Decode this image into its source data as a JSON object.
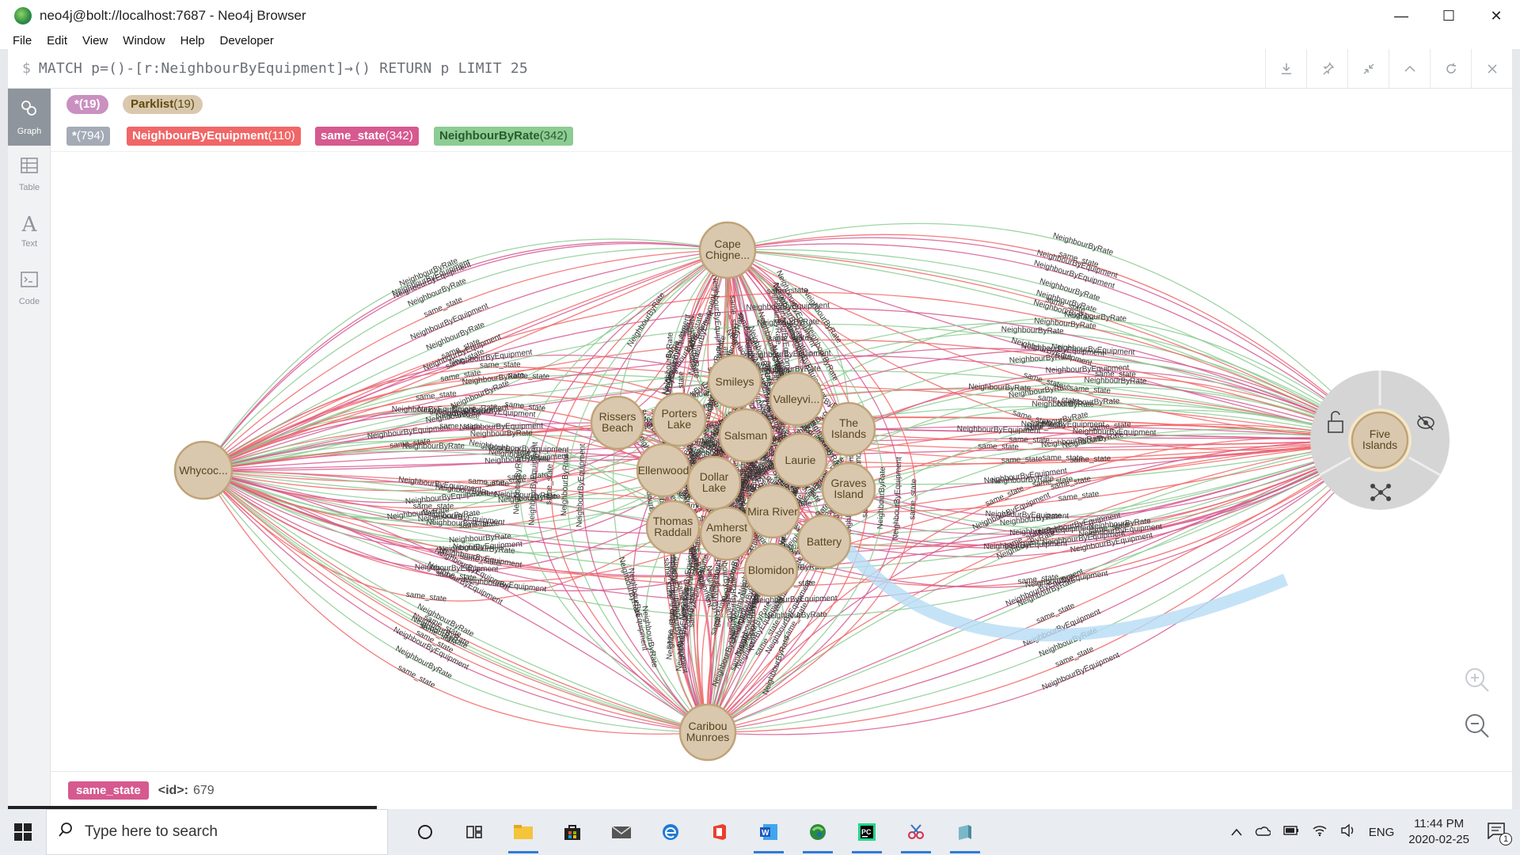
{
  "window": {
    "title": "neo4j@bolt://localhost:7687 - Neo4j Browser",
    "controls": {
      "minimize": "—",
      "maximize": "☐",
      "close": "✕"
    }
  },
  "menu": [
    "File",
    "Edit",
    "View",
    "Window",
    "Help",
    "Developer"
  ],
  "editor": {
    "prompt": "$",
    "query": "MATCH p=()-[r:NeighbourByEquipment]→() RETURN p LIMIT 25",
    "actions": [
      "download-icon",
      "pin-icon",
      "collapse-icon",
      "chevron-up-icon",
      "refresh-icon",
      "close-icon"
    ]
  },
  "sidebar": [
    {
      "label": "Graph",
      "icon": "graph-icon",
      "active": true
    },
    {
      "label": "Table",
      "icon": "table-icon",
      "active": false
    },
    {
      "label": "Text",
      "icon": "text-icon",
      "active": false
    },
    {
      "label": "Code",
      "icon": "code-icon",
      "active": false
    }
  ],
  "legend": {
    "node_labels": [
      {
        "name": "*",
        "count": "(19)",
        "color": "#c990c0",
        "text_color": "#fff"
      },
      {
        "name": "Parklist",
        "count": "(19)",
        "color": "#d9c8ae",
        "text_color": "#604a0e"
      }
    ],
    "rel_types": [
      {
        "name": "*",
        "count": "(794)",
        "color": "#a5abb6",
        "text_color": "#fff"
      },
      {
        "name": "NeighbourByEquipment",
        "count": "(110)",
        "color": "#f16667",
        "text_color": "#fff"
      },
      {
        "name": "same_state",
        "count": "(342)",
        "color": "#d6598f",
        "text_color": "#fff"
      },
      {
        "name": "NeighbourByRate",
        "count": "(342)",
        "color": "#8dcc93",
        "text_color": "#2a5a2f"
      }
    ]
  },
  "graph": {
    "node_fill": "#d9c8ae",
    "node_stroke": "#c0a378",
    "rel_colors": {
      "equipment": "#f16667",
      "state": "#d6598f",
      "rate": "#8dcc93"
    },
    "nodes": [
      {
        "id": "cape",
        "label1": "Cape",
        "label2": "Chigne..."
      },
      {
        "id": "whycoc",
        "label1": "Whycoc...",
        "label2": ""
      },
      {
        "id": "caribou",
        "label1": "Caribou",
        "label2": "Munroes"
      },
      {
        "id": "five",
        "label1": "Five",
        "label2": "Islands"
      },
      {
        "id": "rissers",
        "label1": "Rissers",
        "label2": "Beach"
      },
      {
        "id": "smileys",
        "label1": "Smileys",
        "label2": ""
      },
      {
        "id": "valley",
        "label1": "Valleyvi...",
        "label2": ""
      },
      {
        "id": "porters",
        "label1": "Porters",
        "label2": "Lake"
      },
      {
        "id": "salsman",
        "label1": "Salsman",
        "label2": ""
      },
      {
        "id": "theislands",
        "label1": "The",
        "label2": "Islands"
      },
      {
        "id": "laurie",
        "label1": "Laurie",
        "label2": ""
      },
      {
        "id": "ellenwood",
        "label1": "Ellenwood",
        "label2": ""
      },
      {
        "id": "dollar",
        "label1": "Dollar",
        "label2": "Lake"
      },
      {
        "id": "graves",
        "label1": "Graves",
        "label2": "Island"
      },
      {
        "id": "thomas",
        "label1": "Thomas",
        "label2": "Raddall"
      },
      {
        "id": "amherst",
        "label1": "Amherst",
        "label2": "Shore"
      },
      {
        "id": "mira",
        "label1": "Mira River",
        "label2": ""
      },
      {
        "id": "battery",
        "label1": "Battery",
        "label2": ""
      },
      {
        "id": "blomidon",
        "label1": "Blomidon",
        "label2": ""
      }
    ],
    "edge_labels": [
      "same_state",
      "NeighbourByEquipment",
      "NeighbourByRate"
    ],
    "ring_actions": [
      "unlock-icon",
      "hide-icon",
      "expand-icon"
    ]
  },
  "footer": {
    "tag": "same_state",
    "key": "<id>:",
    "value": "679"
  },
  "taskbar": {
    "search_placeholder": "Type here to search",
    "lang": "ENG",
    "time": "11:44 PM",
    "date": "2020-02-25",
    "notif_count": "1"
  }
}
